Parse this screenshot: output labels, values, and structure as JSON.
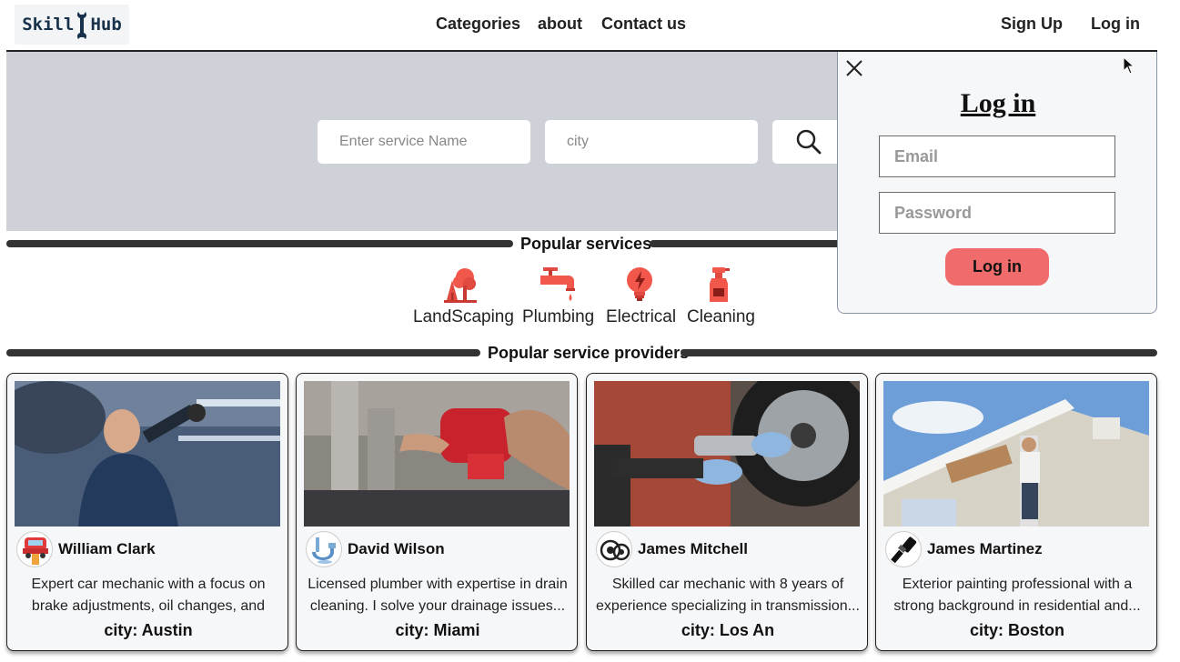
{
  "header": {
    "logo_left": "Skill",
    "logo_right": "Hub",
    "nav": [
      "Categories",
      "about",
      "Contact us"
    ],
    "sign_up": "Sign Up",
    "log_in": "Log in"
  },
  "search": {
    "service_placeholder": "Enter service Name",
    "city_placeholder": "city"
  },
  "popular_services": {
    "title": "Popular services",
    "items": [
      {
        "label": "LandScaping",
        "icon": "tree-icon"
      },
      {
        "label": "Plumbing",
        "icon": "faucet-icon"
      },
      {
        "label": "Electrical",
        "icon": "bulb-icon"
      },
      {
        "label": "Cleaning",
        "icon": "spray-bottle-icon"
      }
    ],
    "icon_color": "#f2574b"
  },
  "providers": {
    "title": "Popular service providers",
    "cards": [
      {
        "name": "William Clark",
        "desc": "Expert car mechanic with a focus on brake adjustments, oil changes, and tire...",
        "city": "city: Austin"
      },
      {
        "name": "David Wilson",
        "desc": "Licensed plumber with expertise in drain cleaning. I solve your drainage issues...",
        "city": "city: Miami"
      },
      {
        "name": "James Mitchell",
        "desc": "Skilled car mechanic with 8 years of experience specializing in transmission...",
        "city": "city: Los An"
      },
      {
        "name": "James Martinez",
        "desc": "Exterior painting professional with a strong background in residential and...",
        "city": "city: Boston"
      }
    ]
  },
  "login_popup": {
    "title": "Log in",
    "email_placeholder": "Email",
    "password_placeholder": "Password",
    "button": "Log in"
  }
}
